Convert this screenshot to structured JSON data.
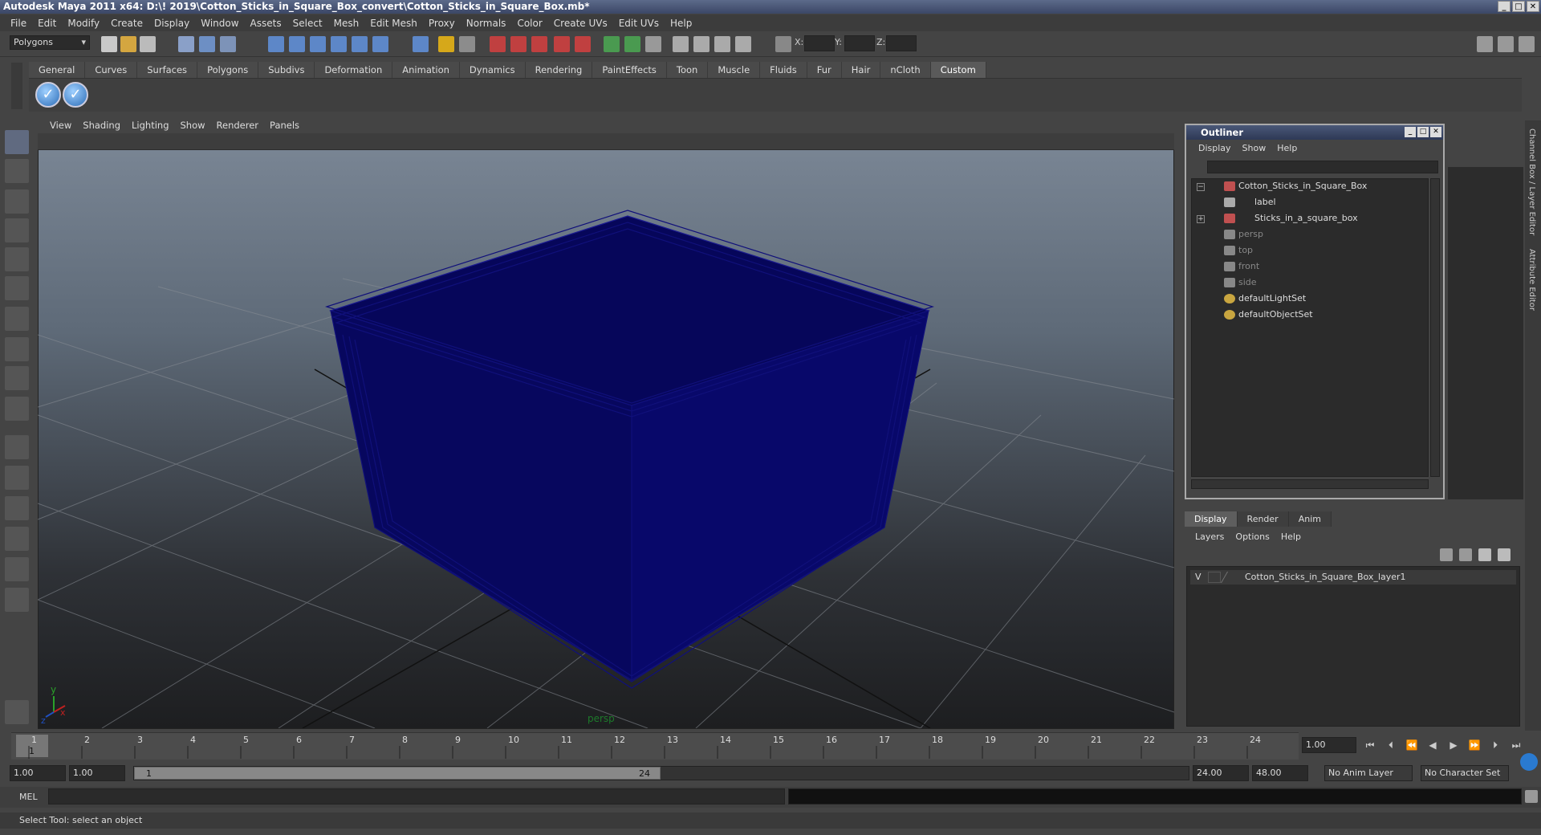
{
  "window": {
    "title": "Autodesk Maya 2011 x64: D:\\! 2019\\Cotton_Sticks_in_Square_Box_convert\\Cotton_Sticks_in_Square_Box.mb*",
    "controls": [
      "_",
      "□",
      "✕"
    ]
  },
  "menubar": [
    "File",
    "Edit",
    "Modify",
    "Create",
    "Display",
    "Window",
    "Assets",
    "Select",
    "Mesh",
    "Edit Mesh",
    "Proxy",
    "Normals",
    "Color",
    "Create UVs",
    "Edit UVs",
    "Help"
  ],
  "statusline": {
    "mode": "Polygons",
    "coord_labels": [
      "X:",
      "Y:",
      "Z:"
    ]
  },
  "shelf": {
    "tabs": [
      "General",
      "Curves",
      "Surfaces",
      "Polygons",
      "Subdivs",
      "Deformation",
      "Animation",
      "Dynamics",
      "Rendering",
      "PaintEffects",
      "Toon",
      "Muscle",
      "Fluids",
      "Fur",
      "Hair",
      "nCloth",
      "Custom"
    ],
    "active_tab": "Custom"
  },
  "viewport": {
    "menu": [
      "View",
      "Shading",
      "Lighting",
      "Show",
      "Renderer",
      "Panels"
    ],
    "camera": "persp",
    "axis_y": "y",
    "axis_x": "x",
    "axis_z": "z",
    "wire_color": "#0a0a6e"
  },
  "outliner": {
    "title": "Outliner",
    "menu": [
      "Display",
      "Show",
      "Help"
    ],
    "items": [
      {
        "label": "Cotton_Sticks_in_Square_Box",
        "icon": "transform-icon",
        "dim": false
      },
      {
        "label": "label",
        "icon": "locator-icon",
        "dim": false
      },
      {
        "label": "Sticks_in_a_square_box",
        "icon": "transform-icon",
        "dim": false
      },
      {
        "label": "persp",
        "icon": "camera-icon",
        "dim": true
      },
      {
        "label": "top",
        "icon": "camera-icon",
        "dim": true
      },
      {
        "label": "front",
        "icon": "camera-icon",
        "dim": true
      },
      {
        "label": "side",
        "icon": "camera-icon",
        "dim": true
      },
      {
        "label": "defaultLightSet",
        "icon": "set-icon",
        "dim": false
      },
      {
        "label": "defaultObjectSet",
        "icon": "set-icon",
        "dim": false
      }
    ]
  },
  "sidetabs": [
    "Channel Box / Layer Editor",
    "Attribute Editor"
  ],
  "layers": {
    "tabs": [
      "Display",
      "Render",
      "Anim"
    ],
    "active_tab": "Display",
    "menu": [
      "Layers",
      "Options",
      "Help"
    ],
    "rows": [
      {
        "visible": "V",
        "name": "Cotton_Sticks_in_Square_Box_layer1"
      }
    ]
  },
  "timeline": {
    "ticks": [
      "1",
      "2",
      "3",
      "4",
      "5",
      "6",
      "7",
      "8",
      "9",
      "10",
      "11",
      "12",
      "13",
      "14",
      "15",
      "16",
      "17",
      "18",
      "19",
      "20",
      "21",
      "22",
      "23",
      "24"
    ],
    "current_frame": "1.00",
    "playhead_label": "1"
  },
  "range": {
    "start": "1.00",
    "playback_start": "1.00",
    "slider_start": "1",
    "slider_end": "24",
    "playback_end": "24.00",
    "end": "48.00",
    "anim_layer": "No Anim Layer",
    "character_set": "No Character Set"
  },
  "command": {
    "label": "MEL"
  },
  "helpline": "Select Tool: select an object"
}
